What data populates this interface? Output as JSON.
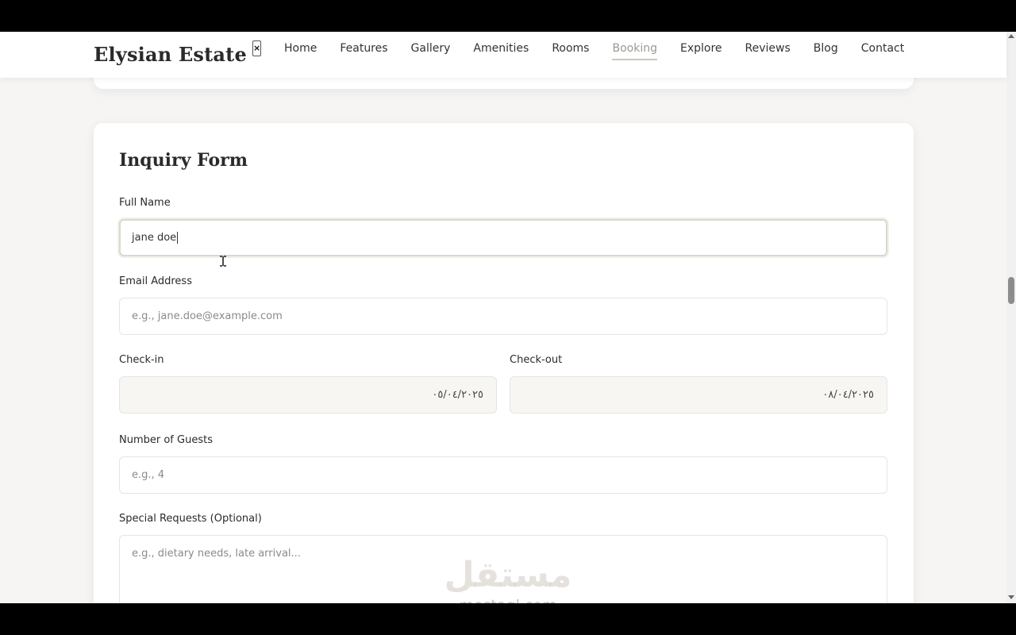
{
  "header": {
    "brand": "Elysian Estate",
    "close_glyph": "×",
    "nav": [
      {
        "label": "Home",
        "active": false
      },
      {
        "label": "Features",
        "active": false
      },
      {
        "label": "Gallery",
        "active": false
      },
      {
        "label": "Amenities",
        "active": false
      },
      {
        "label": "Rooms",
        "active": false
      },
      {
        "label": "Booking",
        "active": true
      },
      {
        "label": "Explore",
        "active": false
      },
      {
        "label": "Reviews",
        "active": false
      },
      {
        "label": "Blog",
        "active": false
      },
      {
        "label": "Contact",
        "active": false
      }
    ]
  },
  "form": {
    "title": "Inquiry Form",
    "full_name": {
      "label": "Full Name",
      "value": "jane doe"
    },
    "email": {
      "label": "Email Address",
      "placeholder": "e.g., jane.doe@example.com"
    },
    "check_in": {
      "label": "Check-in",
      "value": "٠٥/٠٤/٢٠٢٥"
    },
    "check_out": {
      "label": "Check-out",
      "value": "٠٨/٠٤/٢٠٢٥"
    },
    "guests": {
      "label": "Number of Guests",
      "placeholder": "e.g., 4"
    },
    "special_requests": {
      "label": "Special Requests (Optional)",
      "placeholder": "e.g., dietary needs, late arrival..."
    }
  },
  "watermark": {
    "arabic": "مستقل",
    "latin": "mostaql.com"
  },
  "icons": {
    "cursor": "i-beam-cursor-icon",
    "scroll_up": "scroll-up-arrow-icon",
    "scroll_down": "scroll-down-arrow-icon"
  }
}
